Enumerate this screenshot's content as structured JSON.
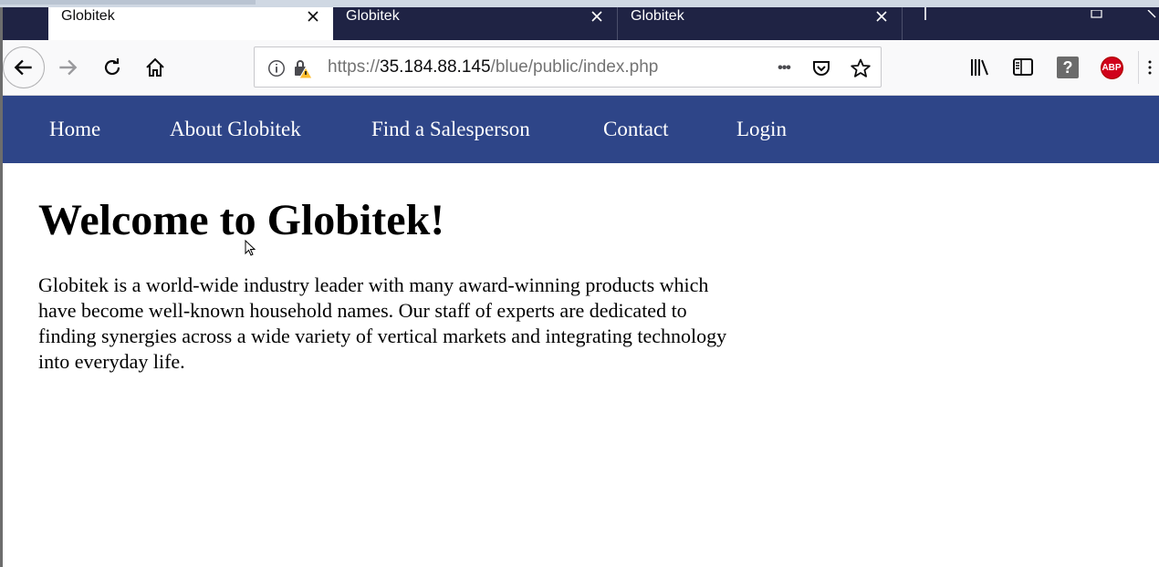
{
  "tabs": [
    {
      "title": "Globitek",
      "active": true
    },
    {
      "title": "Globitek",
      "active": false
    },
    {
      "title": "Globitek",
      "active": false
    }
  ],
  "urlbar": {
    "scheme": "https://",
    "host": "35.184.88.145",
    "path": "/blue/public/index.php"
  },
  "toolbar": {
    "more_label": "•••",
    "abp_label": "ABP",
    "help_label": "?"
  },
  "site_nav": {
    "home": "Home",
    "about": "About Globitek",
    "find": "Find a Salesperson",
    "contact": "Contact",
    "login": "Login"
  },
  "page": {
    "heading": "Welcome to Globitek!",
    "intro": "Globitek is a world-wide industry leader with many award-winning products which have become well-known household names. Our staff of experts are dedicated to finding synergies across a wide variety of vertical markets and integrating technology into everyday life."
  },
  "colors": {
    "tabbar": "#1f2344",
    "site_nav": "#2e4588",
    "abp": "#d0021b"
  },
  "icons": {
    "back": "back-arrow-icon",
    "forward": "forward-arrow-icon",
    "reload": "reload-icon",
    "home": "home-icon",
    "info": "info-icon",
    "insecure": "insecure-lock-icon",
    "pocket": "pocket-icon",
    "bookmark": "star-icon",
    "library": "library-icon",
    "sidebar": "sidebar-icon"
  }
}
